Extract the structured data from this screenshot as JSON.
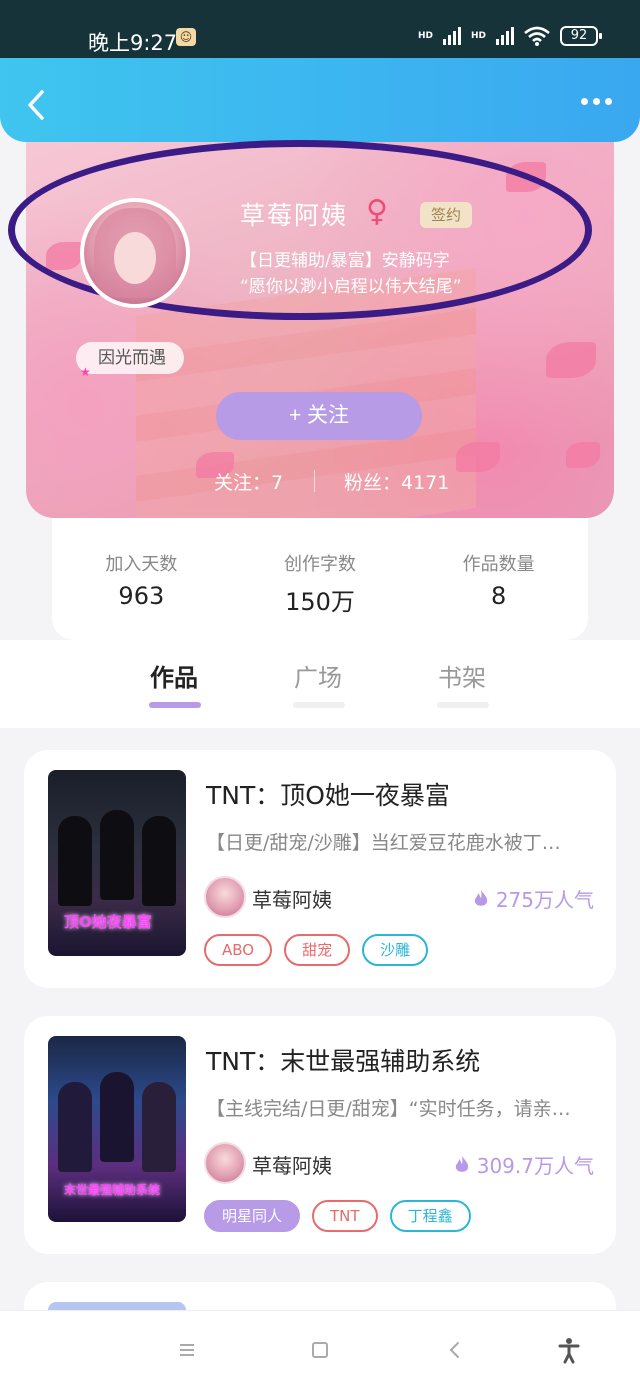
{
  "status_bar": {
    "time": "晚上9:27",
    "network_1": "HD",
    "network_2": "HD",
    "battery": "92"
  },
  "header": {
    "back_icon": "chevron-left-icon",
    "more_icon": "more-dots-icon"
  },
  "profile": {
    "username": "草莓阿姨",
    "gender_symbol": "♀",
    "signed_badge": "签约",
    "bio_line1": "【日更辅助/暴富】安静码字",
    "bio_line2": "“愿你以渺小启程以伟大结尾”",
    "title_badge": "因光而遇",
    "follow_button": "+ 关注",
    "following": "关注：7",
    "followers": "粉丝：4171"
  },
  "stats": [
    {
      "label": "加入天数",
      "value": "963"
    },
    {
      "label": "创作字数",
      "value": "150万"
    },
    {
      "label": "作品数量",
      "value": "8"
    }
  ],
  "tabs": [
    {
      "label": "作品",
      "active": true
    },
    {
      "label": "广场",
      "active": false
    },
    {
      "label": "书架",
      "active": false
    }
  ],
  "books": [
    {
      "title": "TNT：顶O她一夜暴富",
      "description": "【日更/甜宠/沙雕】当红爱豆花鹿水被丁…",
      "author": "草莓阿姨",
      "popularity": "275万人气",
      "cover_text": "顶O她夜暴富",
      "tags": [
        {
          "label": "ABO",
          "style": "red"
        },
        {
          "label": "甜宠",
          "style": "red"
        },
        {
          "label": "沙雕",
          "style": "cyan"
        }
      ]
    },
    {
      "title": "TNT：末世最强辅助系统",
      "description": "【主线完结/日更/甜宠】“实时任务，请亲…",
      "author": "草莓阿姨",
      "popularity": "309.7万人气",
      "cover_text": "末世最强辅助系统",
      "tags": [
        {
          "label": "明星同人",
          "style": "purple"
        },
        {
          "label": "TNT",
          "style": "red"
        },
        {
          "label": "丁程鑫",
          "style": "cyan"
        }
      ]
    }
  ],
  "navbar": {
    "menu_icon": "menu-icon",
    "home_icon": "square-home-icon",
    "back_icon": "triangle-back-icon",
    "accessibility_icon": "accessibility-icon"
  },
  "colors": {
    "header_gradient_start": "#3fc5ef",
    "header_gradient_end": "#3aa8f0",
    "accent_purple": "#b79be6",
    "tag_red": "#e86a6a",
    "tag_cyan": "#2bb6d6",
    "annotation_circle": "#3b1b86"
  }
}
